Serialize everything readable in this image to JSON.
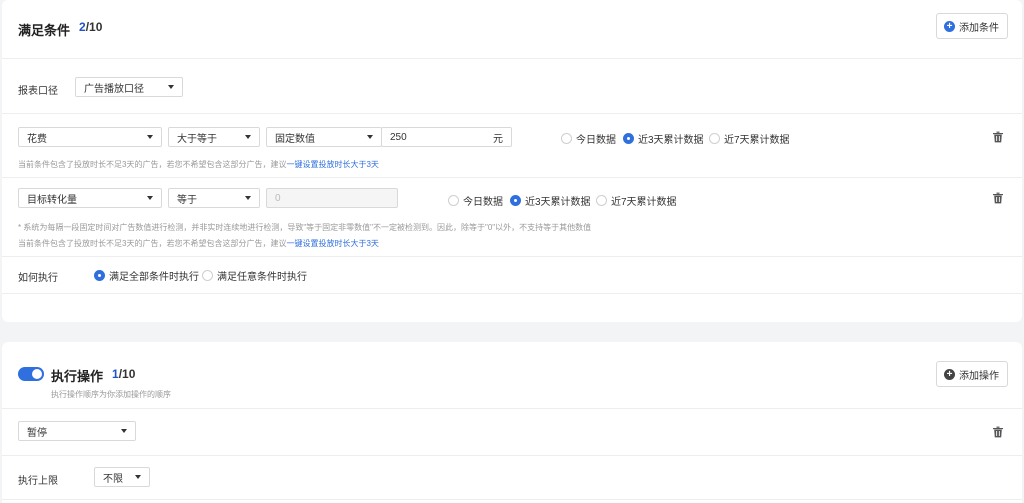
{
  "conditions": {
    "title": "满足条件",
    "count_current": "2",
    "count_total": "/10",
    "add_label": "添加条件",
    "report_scope": {
      "label": "报表口径",
      "value": "广告播放口径"
    },
    "rows": [
      {
        "metric": "花费",
        "operator": "大于等于",
        "value_type": "固定数值",
        "value": "250",
        "unit": "元",
        "ranges": [
          "今日数据",
          "近3天累计数据",
          "近7天累计数据"
        ],
        "selected_range": 1,
        "hint_text": "当前条件包含了投放时长不足3天的广告，若您不希望包含这部分广告，建议",
        "hint_link": "一键设置投放时长大于3天"
      },
      {
        "metric": "目标转化量",
        "operator": "等于",
        "value_placeholder": "0",
        "ranges": [
          "今日数据",
          "近3天累计数据",
          "近7天累计数据"
        ],
        "selected_range": 1,
        "note": "* 系统为每隔一段固定时间对广告数值进行检测，并非实时连续地进行检测，导致\"等于固定非零数值\"不一定被检测到。因此，除等于\"0\"以外，不支持等于其他数值",
        "hint_text": "当前条件包含了投放时长不足3天的广告，若您不希望包含这部分广告，建议",
        "hint_link": "一键设置投放时长大于3天"
      }
    ],
    "execution": {
      "label": "如何执行",
      "options": [
        "满足全部条件时执行",
        "满足任意条件时执行"
      ],
      "selected": 0
    }
  },
  "actions": {
    "enabled": true,
    "title": "执行操作",
    "count_current": "1",
    "count_total": "/10",
    "subtitle": "执行操作顺序为你添加操作的顺序",
    "add_label": "添加操作",
    "action_value": "暂停",
    "limit": {
      "label": "执行上限",
      "value": "不限"
    }
  },
  "colors": {
    "accent": "#2f6fde",
    "background": "#f3f4f6",
    "card": "#ffffff"
  }
}
